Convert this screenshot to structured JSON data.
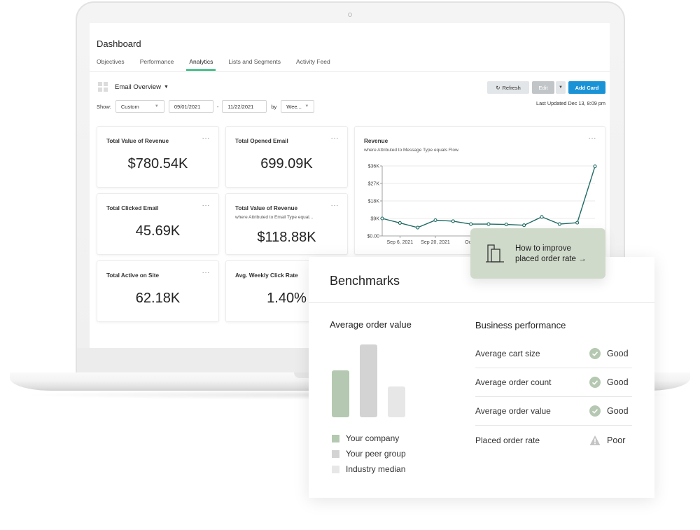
{
  "dashboard": {
    "title": "Dashboard",
    "tabs": [
      {
        "label": "Objectives",
        "active": false
      },
      {
        "label": "Performance",
        "active": false
      },
      {
        "label": "Analytics",
        "active": true
      },
      {
        "label": "Lists and Segments",
        "active": false
      },
      {
        "label": "Activity Feed",
        "active": false
      }
    ],
    "overview_label": "Email Overview",
    "show_label": "Show:",
    "show_value": "Custom",
    "start_date": "09/01/2021",
    "date_sep": "-",
    "end_date": "11/22/2021",
    "by_label": "by",
    "by_value": "Wee...",
    "buttons": {
      "refresh": "Refresh",
      "edit": "Edit",
      "add_card": "Add Card"
    },
    "last_updated": "Last Updated Dec 13, 8:09 pm",
    "cards": [
      {
        "title": "Total Value of Revenue",
        "subtitle": "",
        "value": "$780.54K"
      },
      {
        "title": "Total Opened Email",
        "subtitle": "",
        "value": "699.09K"
      },
      {
        "title": "Total Clicked Email",
        "subtitle": "",
        "value": "45.69K"
      },
      {
        "title": "Total Value of Revenue",
        "subtitle": "where Attributed to Email Type equal...",
        "value": "$118.88K"
      },
      {
        "title": "Total Active on Site",
        "subtitle": "",
        "value": "62.18K"
      },
      {
        "title": "Avg. Weekly Click Rate",
        "subtitle": "",
        "value": "1.40%"
      }
    ],
    "menu_dots": "···",
    "colors": {
      "accent_tab": "#1db36f",
      "add_button": "#1a93d6",
      "line": "#1f6b64"
    }
  },
  "chart_data": {
    "type": "line",
    "title": "Revenue",
    "subtitle": "where Attributed to Message Type equals Flow.",
    "xlabel": "",
    "ylabel": "",
    "ylim": [
      0,
      36000
    ],
    "y_ticks": [
      "$0.00",
      "$9K",
      "$18K",
      "$27K",
      "$36K"
    ],
    "y_tick_values": [
      0,
      9000,
      18000,
      27000,
      36000
    ],
    "x_tick_labels": [
      "Sep 6, 2021",
      "Sep 20, 2021",
      "Oct 4"
    ],
    "x_tick_indices": [
      1,
      3,
      5
    ],
    "grid": true,
    "series": [
      {
        "name": "Revenue",
        "values": [
          9000,
          6700,
          4300,
          8100,
          7600,
          6100,
          6100,
          5900,
          5500,
          9800,
          6100,
          6800,
          35800
        ]
      }
    ]
  },
  "improve_card": {
    "line1": "How to improve",
    "line2": "placed order rate →"
  },
  "benchmarks": {
    "title": "Benchmarks",
    "aov_title": "Average order value",
    "aov_bars": [
      {
        "name": "Your company",
        "relative_value": 0.64,
        "color": "#b5c8b1"
      },
      {
        "name": "Your peer group",
        "relative_value": 1.0,
        "color": "#d3d3d3"
      },
      {
        "name": "Industry median",
        "relative_value": 0.42,
        "color": "#e7e7e7"
      }
    ],
    "bp_title": "Business performance",
    "rows": [
      {
        "label": "Average cart size",
        "status": "Good",
        "icon": "check-circle-icon"
      },
      {
        "label": "Average order count",
        "status": "Good",
        "icon": "check-circle-icon"
      },
      {
        "label": "Average order value",
        "status": "Good",
        "icon": "check-circle-icon"
      },
      {
        "label": "Placed order rate",
        "status": "Poor",
        "icon": "warning-triangle-icon"
      }
    ]
  }
}
